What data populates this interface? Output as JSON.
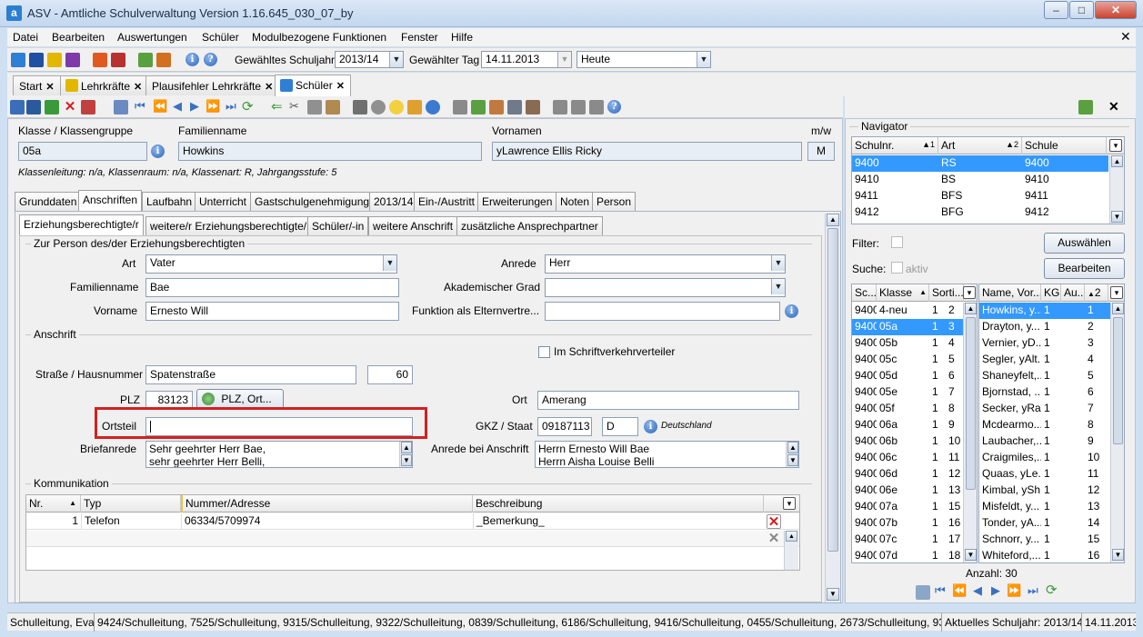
{
  "window": {
    "title": "ASV - Amtliche Schulverwaltung Version 1.16.645_030_07_by",
    "app_icon": "a",
    "minimize": "–",
    "maximize": "□",
    "close": "✕"
  },
  "menu": [
    "Datei",
    "Bearbeiten",
    "Auswertungen",
    "Schüler",
    "Modulbezogene Funktionen",
    "Fenster",
    "Hilfe"
  ],
  "toolbar": {
    "schuljahr_label": "Gewähltes Schuljahr",
    "schuljahr_value": "2013/14",
    "tag_label": "Gewählter Tag",
    "tag_value": "14.11.2013",
    "heute_value": "Heute"
  },
  "doc_tabs": [
    {
      "label": "Start"
    },
    {
      "label": "Lehrkräfte"
    },
    {
      "label": "Plausifehler Lehrkräfte"
    },
    {
      "label": "Schüler"
    }
  ],
  "student": {
    "klasse_label": "Klasse / Klassengruppe",
    "klasse": "05a",
    "familienname_label": "Familienname",
    "familienname": "Howkins",
    "vornamen_label": "Vornamen",
    "vornamen": "yLawrence Ellis Ricky",
    "mw_label": "m/w",
    "mw": "M",
    "info": "Klassenleitung: n/a, Klassenraum: n/a, Klassenart: R, Jahrgangsstufe: 5"
  },
  "main_tabs": [
    "Grunddaten",
    "Anschriften",
    "Laufbahn",
    "Unterricht",
    "Gastschulgenehmigung",
    "2013/14",
    "Ein-/Austritt",
    "Erweiterungen",
    "Noten",
    "Person"
  ],
  "sub_tabs": [
    "Erziehungsberechtigte/r",
    "weitere/r Erziehungsberechtigte/r",
    "Schüler/-in",
    "weitere Anschrift",
    "zusätzliche Ansprechpartner"
  ],
  "person": {
    "group": "Zur Person des/der Erziehungsberechtigten",
    "art_label": "Art",
    "art": "Vater",
    "anrede_label": "Anrede",
    "anrede": "Herr",
    "familienname_label": "Familienname",
    "familienname": "Bae",
    "grad_label": "Akademischer Grad",
    "grad": "",
    "vorname_label": "Vorname",
    "vorname": "Ernesto Will",
    "funktion_label": "Funktion als Elternvertre...",
    "funktion": ""
  },
  "anschrift": {
    "group": "Anschrift",
    "verteiler_label": "Im Schriftverkehrverteiler",
    "strasse_label": "Straße / Hausnummer",
    "strasse": "Spatenstraße",
    "hausnummer": "60",
    "plz_label": "PLZ",
    "plz": "83123",
    "plz_button": "PLZ, Ort...",
    "ort_label": "Ort",
    "ort": "Amerang",
    "ortsteil_label": "Ortsteil",
    "ortsteil": "",
    "gkz_label": "GKZ / Staat",
    "gkz": "09187113",
    "staat": "D",
    "staat_name": "Deutschland",
    "briefanrede_label": "Briefanrede",
    "briefanrede_1": "Sehr geehrter Herr Bae,",
    "briefanrede_2": "sehr geehrter Herr Belli,",
    "anrede_anschrift_label": "Anrede bei Anschrift",
    "anrede_anschrift_1": "Herrn Ernesto Will Bae",
    "anrede_anschrift_2": "Herrn Aisha Louise Belli"
  },
  "kommunikation": {
    "group": "Kommunikation",
    "headers": [
      "Nr.",
      "Typ",
      "Nummer/Adresse",
      "Beschreibung"
    ],
    "rows": [
      {
        "nr": "1",
        "typ": "Telefon",
        "nummer": "06334/5709974",
        "beschreibung": "_Bemerkung_"
      }
    ]
  },
  "navigator": {
    "title": "Navigator",
    "school_headers": [
      "Schulnr.",
      "Art",
      "Schule"
    ],
    "school_sort": [
      "1",
      "2"
    ],
    "schools": [
      [
        "9400",
        "RS",
        "9400"
      ],
      [
        "9410",
        "BS",
        "9410"
      ],
      [
        "9411",
        "BFS",
        "9411"
      ],
      [
        "9412",
        "BFG",
        "9412"
      ]
    ],
    "filter_label": "Filter:",
    "suche_label": "Suche:",
    "aktiv_label": "aktiv",
    "auswaehlen": "Auswählen",
    "bearbeiten": "Bearbeiten",
    "class_headers": [
      "Sc...",
      "Klasse",
      "Sorti..."
    ],
    "classes": [
      [
        "9400",
        "4-neu",
        "1",
        "2"
      ],
      [
        "9400",
        "05a",
        "1",
        "3"
      ],
      [
        "9400",
        "05b",
        "1",
        "4"
      ],
      [
        "9400",
        "05c",
        "1",
        "5"
      ],
      [
        "9400",
        "05d",
        "1",
        "6"
      ],
      [
        "9400",
        "05e",
        "1",
        "7"
      ],
      [
        "9400",
        "05f",
        "1",
        "8"
      ],
      [
        "9400",
        "06a",
        "1",
        "9"
      ],
      [
        "9400",
        "06b",
        "1",
        "10"
      ],
      [
        "9400",
        "06c",
        "1",
        "11"
      ],
      [
        "9400",
        "06d",
        "1",
        "12"
      ],
      [
        "9400",
        "06e",
        "1",
        "13"
      ],
      [
        "9400",
        "07a",
        "1",
        "15"
      ],
      [
        "9400",
        "07b",
        "1",
        "16"
      ],
      [
        "9400",
        "07c",
        "1",
        "17"
      ],
      [
        "9400",
        "07d",
        "1",
        "18"
      ]
    ],
    "student_headers": [
      "Name, Vor...",
      "KG",
      "Au...",
      "2"
    ],
    "students": [
      [
        "Howkins, y...",
        "1",
        "1"
      ],
      [
        "Drayton, y...",
        "1",
        "2"
      ],
      [
        "Vernier, yD...",
        "1",
        "3"
      ],
      [
        "Segler, yAlt...",
        "1",
        "4"
      ],
      [
        "Shaneyfelt,...",
        "1",
        "5"
      ],
      [
        "Bjornstad, ...",
        "1",
        "6"
      ],
      [
        "Secker, yRa...",
        "1",
        "7"
      ],
      [
        "Mcdearmo...",
        "1",
        "8"
      ],
      [
        "Laubacher,...",
        "1",
        "9"
      ],
      [
        "Craigmiles,...",
        "1",
        "10"
      ],
      [
        "Quaas, yLe...",
        "1",
        "11"
      ],
      [
        "Kimbal, ySh...",
        "1",
        "12"
      ],
      [
        "Misfeldt, y...",
        "1",
        "13"
      ],
      [
        "Tonder, yA...",
        "1",
        "14"
      ],
      [
        "Schnorr, y...",
        "1",
        "15"
      ],
      [
        "Whiteford,...",
        "1",
        "16"
      ]
    ],
    "anzahl": "Anzahl: 30"
  },
  "status": [
    "Schulleitung, Eva",
    "9424/Schulleitung, 7525/Schulleitung, 9315/Schulleitung, 9322/Schulleitung, 0839/Schulleitung, 6186/Schulleitung, 9416/Schulleitung, 0455/Schulleitung, 2673/Schulleitung, 9303/S",
    "Aktuelles Schuljahr: 2013/14",
    "14.11.2013"
  ]
}
